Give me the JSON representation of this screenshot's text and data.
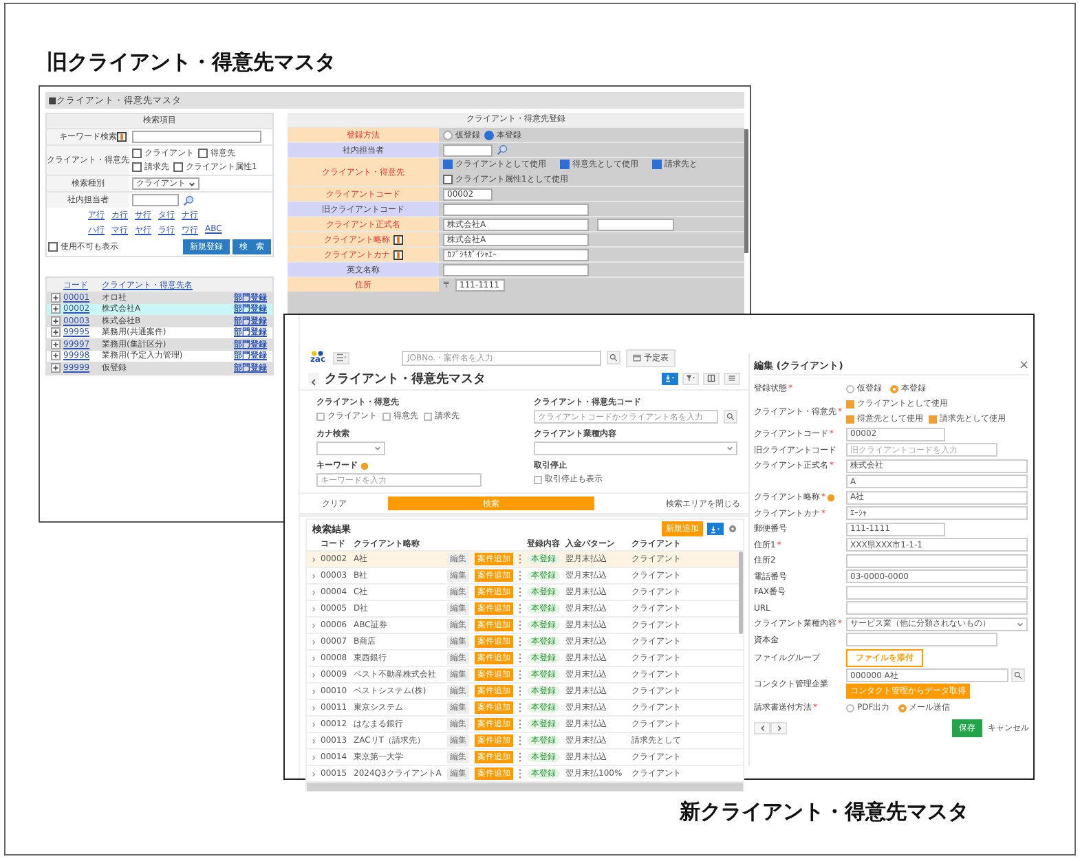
{
  "old_title": "旧クライアント・得意先マスタ",
  "new_title": "新クライアント・得意先マスタ",
  "old_screen": {
    "title": "■クライアント・得意先マスタ",
    "search": {
      "header": "検索項目",
      "rows": [
        {
          "kind": "keyword",
          "label": "キーワード検索",
          "note": true
        },
        {
          "kind": "checks",
          "label": "クライアント・得意先",
          "options": [
            {
              "label": "クライアント",
              "checked": false
            },
            {
              "label": "得意先",
              "checked": false
            },
            {
              "label": "請求先",
              "checked": false
            },
            {
              "label": "クライアント属性1",
              "checked": false
            }
          ]
        },
        {
          "kind": "select",
          "label": "検索種別",
          "value": "クライアント"
        },
        {
          "kind": "staff",
          "label": "社内担当者"
        }
      ],
      "kana_rows": [
        [
          "ア行",
          "カ行",
          "サ行",
          "タ行",
          "ナ行"
        ],
        [
          "ハ行",
          "マ行",
          "ヤ行",
          "ラ行",
          "ワ行",
          "ABC"
        ]
      ],
      "show_disabled": {
        "label": "使用不可も表示",
        "checked": false
      },
      "buttons": [
        "新規登録",
        "検　索"
      ]
    },
    "list": {
      "columns": [
        "コード",
        "クライアント・得意先名"
      ],
      "rows": [
        {
          "code": "00001",
          "name": "オロ社",
          "link": "部門登録",
          "selected": false
        },
        {
          "code": "00002",
          "name": "株式会社A",
          "link": "部門登録",
          "selected": true
        },
        {
          "code": "00003",
          "name": "株式会社B",
          "link": "部門登録",
          "selected": false
        },
        {
          "code": "99995",
          "name": "業務用(共通案件)",
          "link": "部門登録",
          "selected": false
        },
        {
          "code": "99997",
          "name": "業務用(集計区分)",
          "link": "部門登録",
          "selected": false
        },
        {
          "code": "99998",
          "name": "業務用(予定入力管理)",
          "link": "部門登録",
          "selected": false
        },
        {
          "code": "99999",
          "name": "仮登録",
          "link": "部門登録",
          "selected": false
        }
      ]
    },
    "form": {
      "header": "クライアント・得意先登録",
      "rows": [
        {
          "kind": "radio",
          "label": "登録方法",
          "required": true,
          "options": [
            {
              "label": "仮登録",
              "selected": false
            },
            {
              "label": "本登録",
              "selected": true
            }
          ]
        },
        {
          "kind": "staff",
          "label": "社内担当者",
          "required": false
        },
        {
          "kind": "checks",
          "label": "クライアント・得意先",
          "required": true,
          "options": [
            {
              "label": "クライアントとして使用",
              "checked": true
            },
            {
              "label": "得意先として使用",
              "checked": true
            },
            {
              "label": "請求先と",
              "checked": true
            },
            {
              "label": "クライアント属性1として使用",
              "checked": false
            }
          ]
        },
        {
          "kind": "code",
          "label": "クライアントコード",
          "required": true,
          "value": "00002"
        },
        {
          "kind": "text",
          "label": "旧クライアントコード",
          "required": false
        },
        {
          "kind": "pair",
          "label": "クライアント正式名",
          "required": true,
          "value": "株式会社A"
        },
        {
          "kind": "text",
          "label": "クライアント略称",
          "required": true,
          "note": true,
          "value": "株式会社A"
        },
        {
          "kind": "text",
          "label": "クライアントカナ",
          "required": true,
          "note": true,
          "value": "ｶﾌﾞｼｷｶﾞｲｼｬｴｰ"
        },
        {
          "kind": "text",
          "label": "英文名称",
          "required": false
        },
        {
          "kind": "zip",
          "label": "住所",
          "required": true,
          "mark": "〒",
          "value": "111-1111"
        }
      ]
    }
  },
  "new_screen": {
    "header": {
      "logo_text": "zac",
      "search_placeholder": "JOBNo.・案件名を入力",
      "schedule_button": "予定表"
    },
    "title": "クライアント・得意先マスタ",
    "search_fields": [
      {
        "kind": "checks",
        "label": "クライアント・得意先",
        "options": [
          {
            "label": "クライアント",
            "checked": false
          },
          {
            "label": "得意先",
            "checked": false
          },
          {
            "label": "請求先",
            "checked": false
          }
        ]
      },
      {
        "kind": "search",
        "label": "クライアント・得意先コード",
        "placeholder": "クライアントコードかクライアント名を入力"
      },
      {
        "kind": "select",
        "label": "カナ検索"
      },
      {
        "kind": "select",
        "label": "クライアント業種内容"
      },
      {
        "kind": "text",
        "label": "キーワード",
        "help": true,
        "placeholder": "キーワードを入力"
      },
      {
        "kind": "check",
        "label": "取引停止",
        "option": {
          "label": "取引停止も表示",
          "checked": false
        }
      }
    ],
    "actions": {
      "clear": "クリア",
      "search": "検索",
      "close": "検索エリアを閉じる"
    },
    "results": {
      "title": "検索結果",
      "add_button": "新規追加",
      "columns": [
        "コード",
        "クライアント略称",
        "登録内容",
        "入金パターン",
        "クライアント"
      ],
      "rows": [
        {
          "code": "00002",
          "name": "A社",
          "edit": "編集",
          "add": "案件追加",
          "status": "本登録",
          "payment": "翌月末払込",
          "type": "クライアント",
          "selected": true
        },
        {
          "code": "00003",
          "name": "B社",
          "edit": "編集",
          "add": "案件追加",
          "status": "本登録",
          "payment": "翌月末払込",
          "type": "クライアント",
          "selected": false
        },
        {
          "code": "00004",
          "name": "C社",
          "edit": "編集",
          "add": "案件追加",
          "status": "本登録",
          "payment": "翌月末払込",
          "type": "クライアント",
          "selected": false
        },
        {
          "code": "00005",
          "name": "D社",
          "edit": "編集",
          "add": "案件追加",
          "status": "本登録",
          "payment": "翌月末払込",
          "type": "クライアント",
          "selected": false
        },
        {
          "code": "00006",
          "name": "ABC証券",
          "edit": "編集",
          "add": "案件追加",
          "status": "本登録",
          "payment": "翌月末払込",
          "type": "クライアント",
          "selected": false
        },
        {
          "code": "00007",
          "name": "B商店",
          "edit": "編集",
          "add": "案件追加",
          "status": "本登録",
          "payment": "翌月末払込",
          "type": "クライアント",
          "selected": false
        },
        {
          "code": "00008",
          "name": "東西銀行",
          "edit": "編集",
          "add": "案件追加",
          "status": "本登録",
          "payment": "翌月末払込",
          "type": "クライアント",
          "selected": false
        },
        {
          "code": "00009",
          "name": "ベスト不動産株式会社",
          "edit": "編集",
          "add": "案件追加",
          "status": "本登録",
          "payment": "翌月末払込",
          "type": "クライアント",
          "selected": false
        },
        {
          "code": "00010",
          "name": "ベストシステム(株)",
          "edit": "編集",
          "add": "案件追加",
          "status": "本登録",
          "payment": "翌月末払込",
          "type": "クライアント",
          "selected": false
        },
        {
          "code": "00011",
          "name": "東京システム",
          "edit": "編集",
          "add": "案件追加",
          "status": "本登録",
          "payment": "翌月末払込",
          "type": "クライアント",
          "selected": false
        },
        {
          "code": "00012",
          "name": "はなまる銀行",
          "edit": "編集",
          "add": "案件追加",
          "status": "本登録",
          "payment": "翌月末払込",
          "type": "クライアント",
          "selected": false
        },
        {
          "code": "00013",
          "name": "ZACリT（請求先）",
          "edit": "編集",
          "add": "案件追加",
          "status": "本登録",
          "payment": "翌月末払込",
          "type": "請求先として",
          "selected": false
        },
        {
          "code": "00014",
          "name": "東京第一大学",
          "edit": "編集",
          "add": "案件追加",
          "status": "本登録",
          "payment": "翌月末払込",
          "type": "クライアント",
          "selected": false
        },
        {
          "code": "00015",
          "name": "2024Q3クライアントA",
          "edit": "編集",
          "add": "案件追加",
          "status": "本登録",
          "payment": "翌月末払100%",
          "type": "クライアント",
          "selected": false
        }
      ]
    },
    "edit_panel": {
      "title": "編集 (クライアント)",
      "close": "×",
      "fields": [
        {
          "kind": "radio",
          "label": "登録状態",
          "mark": "*",
          "options": [
            {
              "label": "仮登録",
              "selected": false
            },
            {
              "label": "本登録",
              "selected": true
            }
          ]
        },
        {
          "kind": "checks",
          "label": "クライアント・得意先",
          "mark": "*",
          "options": [
            {
              "label": "クライアントとして使用",
              "checked": true
            },
            {
              "label": "得意先として使用",
              "checked": true
            },
            {
              "label": "請求先として使用",
              "checked": true
            }
          ]
        },
        {
          "kind": "short",
          "label": "クライアントコード",
          "mark": "*",
          "value": "00002"
        },
        {
          "kind": "short",
          "label": "旧クライアントコード",
          "placeholder": "旧クライアントコードを入力"
        },
        {
          "kind": "text",
          "label": "クライアント正式名",
          "mark": "*",
          "value": "株式会社"
        },
        {
          "kind": "text",
          "value": "A"
        },
        {
          "kind": "text",
          "label": "クライアント略称",
          "mark": "*",
          "help": true,
          "value": "A社"
        },
        {
          "kind": "text",
          "label": "クライアントカナ",
          "mark": "*",
          "value": "ｴｰｼｬ"
        },
        {
          "kind": "short",
          "label": "郵便番号",
          "value": "111-1111"
        },
        {
          "kind": "text",
          "label": "住所1",
          "mark": "*",
          "value": "XXX県XXX市1-1-1"
        },
        {
          "kind": "text",
          "label": "住所2"
        },
        {
          "kind": "text",
          "label": "電話番号",
          "value": "03-0000-0000"
        },
        {
          "kind": "text",
          "label": "FAX番号"
        },
        {
          "kind": "text",
          "label": "URL"
        },
        {
          "kind": "select",
          "label": "クライアント業種内容",
          "mark": "*",
          "value": "サービス業（他に分類されないもの）"
        },
        {
          "kind": "short",
          "label": "資本金"
        },
        {
          "kind": "file",
          "label": "ファイルグループ",
          "button": "ファイルを添付"
        },
        {
          "kind": "contact",
          "label": "コンタクト管理企業",
          "value": "000000 A社",
          "button": "コンタクト管理からデータ取得"
        },
        {
          "kind": "radio",
          "label": "請求書送付方法",
          "mark": "*",
          "options": [
            {
              "label": "PDF出力",
              "selected": false
            },
            {
              "label": "メール送信",
              "selected": true
            }
          ]
        }
      ],
      "save": "保存",
      "cancel": "キャンセル"
    }
  }
}
